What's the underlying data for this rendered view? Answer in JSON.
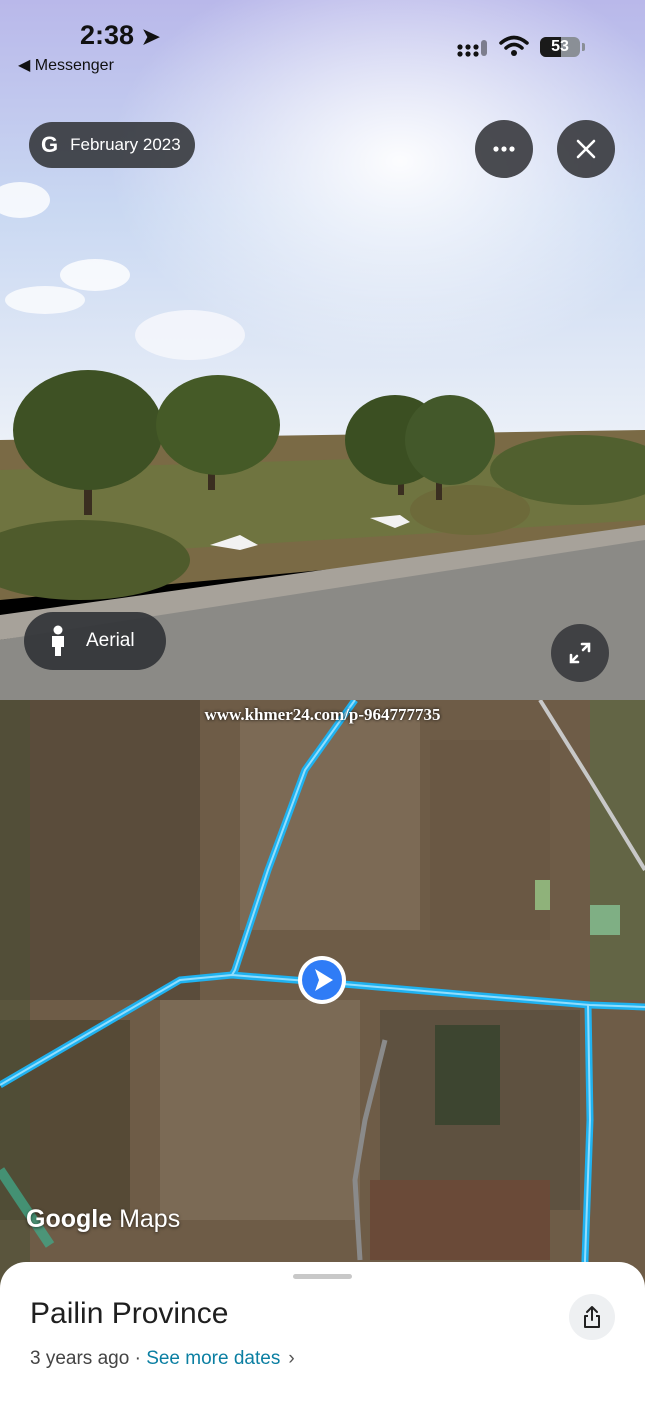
{
  "status_bar": {
    "time": "2:38",
    "back_app": "Messenger",
    "battery": "53",
    "battery_level": 0.53
  },
  "street_view": {
    "date_label": "February 2023",
    "google_glyph": "G",
    "more_icon": "ellipsis-icon",
    "close_icon": "close-icon",
    "mode_button": "Aerial",
    "expand_icon": "expand-icon"
  },
  "map": {
    "watermark": "www.khmer24.com/p-964777735",
    "brand": "Google",
    "brand_suffix": "Maps",
    "colors": {
      "road_highlight": "#1fb2f0",
      "location_marker": "#2f7cf6"
    }
  },
  "place": {
    "name": "Pailin Province",
    "age": "3 years ago",
    "separator": " · ",
    "see_more": "See more dates",
    "share_icon": "share-icon"
  }
}
